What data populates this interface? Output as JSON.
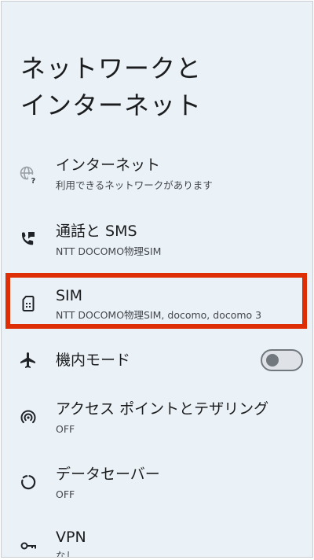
{
  "header": {
    "title_line1": "ネットワークと",
    "title_line2": "インターネット"
  },
  "items": [
    {
      "title": "インターネット",
      "summary": "利用できるネットワークがあります",
      "icon": "globe-question-icon"
    },
    {
      "title": "通話と SMS",
      "summary": "NTT DOCOMO物理SIM",
      "icon": "phone-message-icon"
    },
    {
      "title": "SIM",
      "summary": "NTT DOCOMO物理SIM, docomo, docomo 3",
      "icon": "sim-card-icon"
    },
    {
      "title": "機内モード",
      "summary": "",
      "icon": "airplane-icon",
      "toggle_on": false
    },
    {
      "title": "アクセス ポイントとテザリング",
      "summary": "OFF",
      "icon": "hotspot-icon"
    },
    {
      "title": "データセーバー",
      "summary": "OFF",
      "icon": "data-saver-icon"
    },
    {
      "title": "VPN",
      "summary": "なし",
      "icon": "vpn-key-icon"
    }
  ],
  "colors": {
    "background": "#eaf1f7",
    "highlight": "#dd2e06",
    "text_primary": "#1b1c1e",
    "text_secondary": "#43474b"
  }
}
